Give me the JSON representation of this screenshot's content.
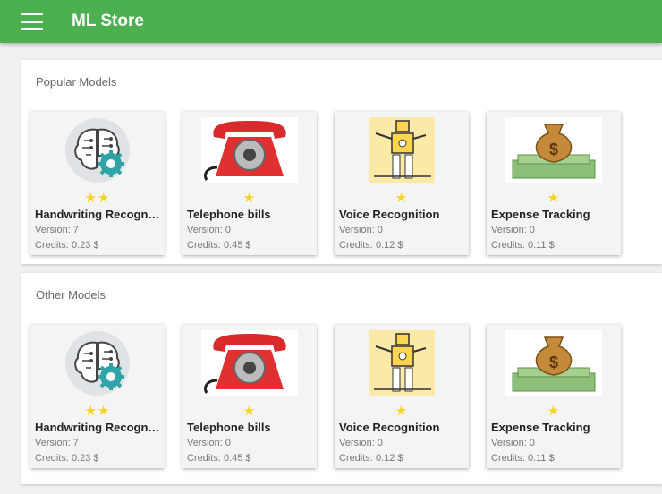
{
  "app": {
    "title": "ML Store"
  },
  "sections": [
    {
      "title": "Popular Models",
      "models": [
        {
          "name": "Handwriting Recognition",
          "stars": "★★",
          "version": "Version: 7",
          "credits": "Credits: 0.23 $",
          "icon": "brain-gear-icon"
        },
        {
          "name": "Telephone bills",
          "stars": "★",
          "version": "Version: 0",
          "credits": "Credits: 0.45 $",
          "icon": "telephone-icon"
        },
        {
          "name": "Voice Recognition",
          "stars": "★",
          "version": "Version: 0",
          "credits": "Credits: 0.12 $",
          "icon": "robot-icon"
        },
        {
          "name": "Expense Tracking",
          "stars": "★",
          "version": "Version: 0",
          "credits": "Credits: 0.11 $",
          "icon": "money-bag-icon"
        }
      ]
    },
    {
      "title": "Other Models",
      "models": [
        {
          "name": "Handwriting Recognition",
          "stars": "★★",
          "version": "Version: 7",
          "credits": "Credits: 0.23 $",
          "icon": "brain-gear-icon"
        },
        {
          "name": "Telephone bills",
          "stars": "★",
          "version": "Version: 0",
          "credits": "Credits: 0.45 $",
          "icon": "telephone-icon"
        },
        {
          "name": "Voice Recognition",
          "stars": "★",
          "version": "Version: 0",
          "credits": "Credits: 0.12 $",
          "icon": "robot-icon"
        },
        {
          "name": "Expense Tracking",
          "stars": "★",
          "version": "Version: 0",
          "credits": "Credits: 0.11 $",
          "icon": "money-bag-icon"
        }
      ]
    }
  ],
  "colors": {
    "appbar": "#4caf50",
    "star": "#f5d321"
  }
}
